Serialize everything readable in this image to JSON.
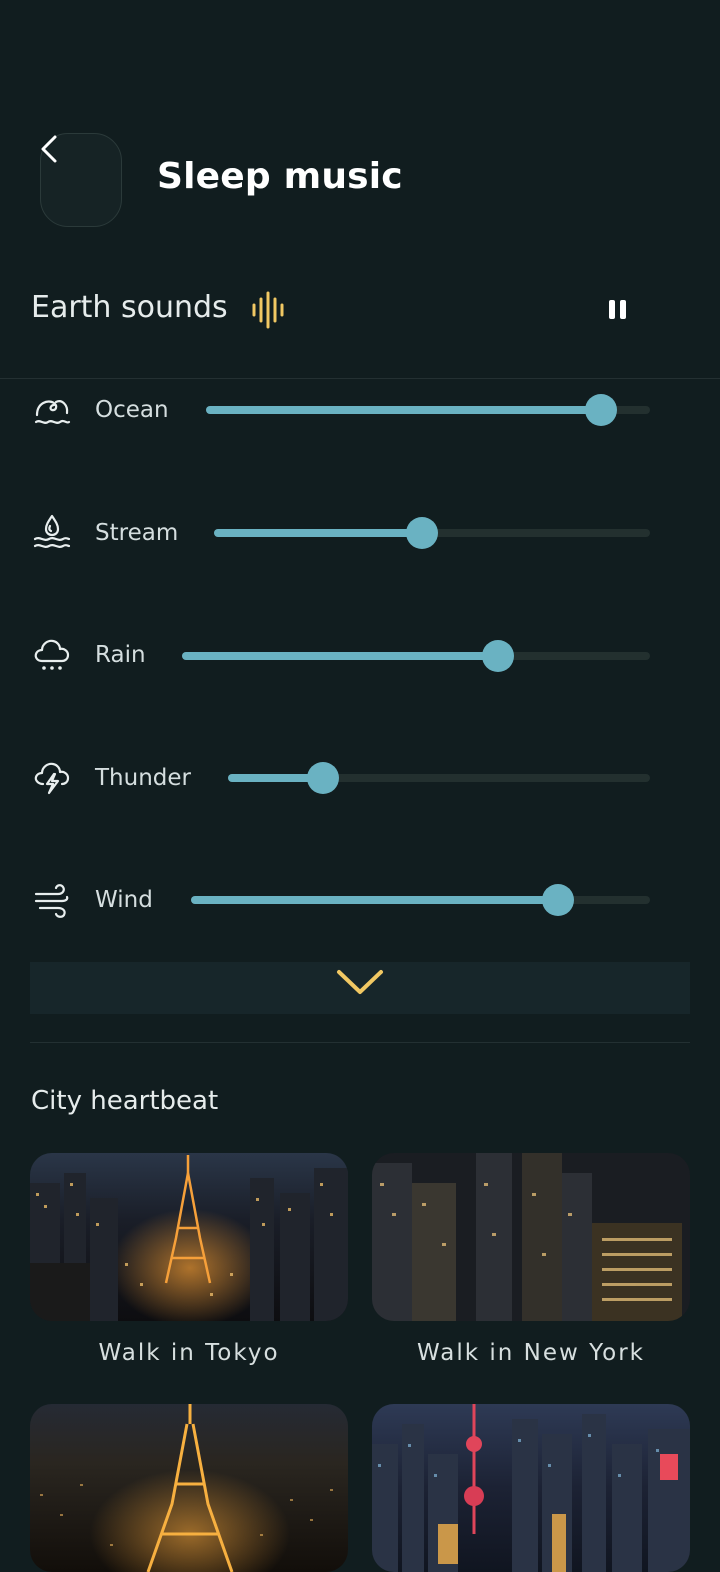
{
  "header": {
    "title": "Sleep music"
  },
  "section": {
    "title": "Earth sounds"
  },
  "sounds": [
    {
      "label": "Ocean",
      "icon": "ocean-icon",
      "volume": 0.89
    },
    {
      "label": "Stream",
      "icon": "stream-icon",
      "volume": 0.476
    },
    {
      "label": "Rain",
      "icon": "rain-icon",
      "volume": 0.675
    },
    {
      "label": "Thunder",
      "icon": "thunder-icon",
      "volume": 0.225
    },
    {
      "label": "Wind",
      "icon": "wind-icon",
      "volume": 0.8
    }
  ],
  "city": {
    "title": "City heartbeat",
    "cards": [
      {
        "caption": "Walk in Tokyo"
      },
      {
        "caption": "Walk in New York"
      },
      {
        "caption": ""
      },
      {
        "caption": ""
      }
    ]
  },
  "colors": {
    "background": "#111d1f",
    "accent": "#6ab2c2",
    "highlight": "#f1c863"
  }
}
